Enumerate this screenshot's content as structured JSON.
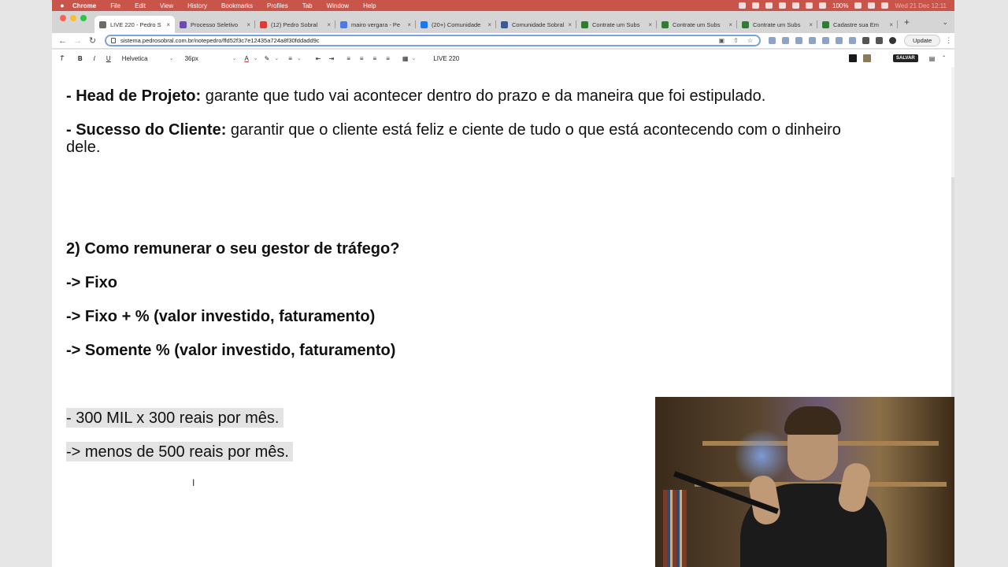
{
  "menubar": {
    "app": "Chrome",
    "items": [
      "File",
      "Edit",
      "View",
      "History",
      "Bookmarks",
      "Profiles",
      "Tab",
      "Window",
      "Help"
    ],
    "battery": "100%",
    "clock": "Wed 21 Dec  12:11"
  },
  "tabs": [
    {
      "title": "LIVE 220 - Pedro S",
      "color": "#6b6b6b",
      "active": true
    },
    {
      "title": "Processo Seletivo",
      "color": "#6c4bb6",
      "active": false
    },
    {
      "title": "(12) Pedro Sobral",
      "color": "#e53935",
      "active": false
    },
    {
      "title": "mairo vergara - Pe",
      "color": "#4a7be6",
      "active": false
    },
    {
      "title": "(20+) Comunidade",
      "color": "#1877f2",
      "active": false
    },
    {
      "title": "Comunidade Sobral",
      "color": "#3b5998",
      "active": false
    },
    {
      "title": "Contrate um Subs",
      "color": "#2e7d32",
      "active": false
    },
    {
      "title": "Contrate um Subs",
      "color": "#2e7d32",
      "active": false
    },
    {
      "title": "Contrate um Subs",
      "color": "#2e7d32",
      "active": false
    },
    {
      "title": "Cadastre sua Em",
      "color": "#2e7d32",
      "active": false
    }
  ],
  "address": {
    "url": "sistema.pedrosobral.com.br/notepedro/ffd52f3c7e12435a724a8f30fddadd9c",
    "update_label": "Update"
  },
  "editor_toolbar": {
    "bold": "B",
    "italic": "I",
    "underline": "U",
    "font": "Helvetica",
    "size": "36px",
    "text_color_glyph": "A",
    "doc_title": "LIVE 220",
    "save_label": "SALVAR",
    "swatch1": "#1a1a1a",
    "swatch2": "#8a7a5c"
  },
  "document": {
    "head_label": "- Head de Projeto:",
    "head_text": " garante que tudo vai acontecer dentro do prazo e da maneira que foi estipulado.",
    "sucesso_label": "- Sucesso do Cliente:",
    "sucesso_text_1": " garantir que o cliente está feliz e ciente de tudo o que está acontecendo com o dinheiro",
    "sucesso_text_2": "dele.",
    "heading2": "2) Como remunerar o seu gestor de tráfego?",
    "opt1": "-> Fixo",
    "opt2": "-> Fixo + % (valor investido, faturamento)",
    "opt3": "-> Somente % (valor investido, faturamento)",
    "sel1": "- 300 MIL  x 300 reais por mês.",
    "sel2": "-> menos de 500 reais por mês."
  }
}
